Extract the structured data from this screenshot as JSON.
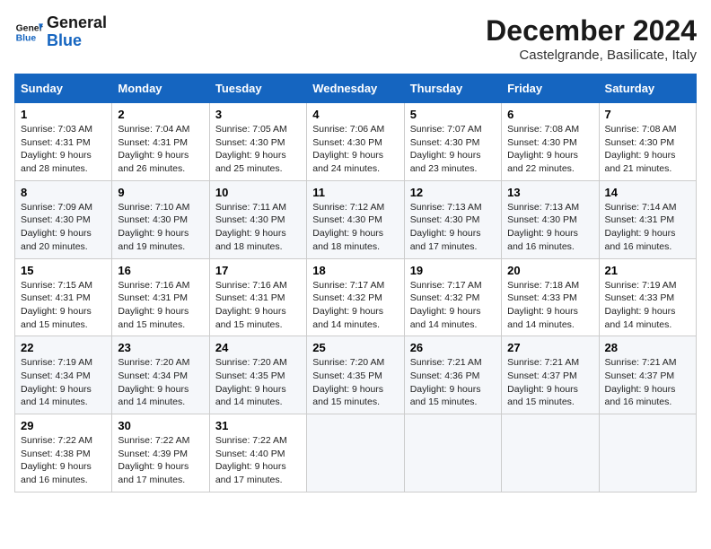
{
  "logo": {
    "line1": "General",
    "line2": "Blue"
  },
  "title": "December 2024",
  "location": "Castelgrande, Basilicate, Italy",
  "days_of_week": [
    "Sunday",
    "Monday",
    "Tuesday",
    "Wednesday",
    "Thursday",
    "Friday",
    "Saturday"
  ],
  "weeks": [
    [
      {
        "day": "1",
        "sunrise": "7:03 AM",
        "sunset": "4:31 PM",
        "daylight": "9 hours and 28 minutes."
      },
      {
        "day": "2",
        "sunrise": "7:04 AM",
        "sunset": "4:31 PM",
        "daylight": "9 hours and 26 minutes."
      },
      {
        "day": "3",
        "sunrise": "7:05 AM",
        "sunset": "4:30 PM",
        "daylight": "9 hours and 25 minutes."
      },
      {
        "day": "4",
        "sunrise": "7:06 AM",
        "sunset": "4:30 PM",
        "daylight": "9 hours and 24 minutes."
      },
      {
        "day": "5",
        "sunrise": "7:07 AM",
        "sunset": "4:30 PM",
        "daylight": "9 hours and 23 minutes."
      },
      {
        "day": "6",
        "sunrise": "7:08 AM",
        "sunset": "4:30 PM",
        "daylight": "9 hours and 22 minutes."
      },
      {
        "day": "7",
        "sunrise": "7:08 AM",
        "sunset": "4:30 PM",
        "daylight": "9 hours and 21 minutes."
      }
    ],
    [
      {
        "day": "8",
        "sunrise": "7:09 AM",
        "sunset": "4:30 PM",
        "daylight": "9 hours and 20 minutes."
      },
      {
        "day": "9",
        "sunrise": "7:10 AM",
        "sunset": "4:30 PM",
        "daylight": "9 hours and 19 minutes."
      },
      {
        "day": "10",
        "sunrise": "7:11 AM",
        "sunset": "4:30 PM",
        "daylight": "9 hours and 18 minutes."
      },
      {
        "day": "11",
        "sunrise": "7:12 AM",
        "sunset": "4:30 PM",
        "daylight": "9 hours and 18 minutes."
      },
      {
        "day": "12",
        "sunrise": "7:13 AM",
        "sunset": "4:30 PM",
        "daylight": "9 hours and 17 minutes."
      },
      {
        "day": "13",
        "sunrise": "7:13 AM",
        "sunset": "4:30 PM",
        "daylight": "9 hours and 16 minutes."
      },
      {
        "day": "14",
        "sunrise": "7:14 AM",
        "sunset": "4:31 PM",
        "daylight": "9 hours and 16 minutes."
      }
    ],
    [
      {
        "day": "15",
        "sunrise": "7:15 AM",
        "sunset": "4:31 PM",
        "daylight": "9 hours and 15 minutes."
      },
      {
        "day": "16",
        "sunrise": "7:16 AM",
        "sunset": "4:31 PM",
        "daylight": "9 hours and 15 minutes."
      },
      {
        "day": "17",
        "sunrise": "7:16 AM",
        "sunset": "4:31 PM",
        "daylight": "9 hours and 15 minutes."
      },
      {
        "day": "18",
        "sunrise": "7:17 AM",
        "sunset": "4:32 PM",
        "daylight": "9 hours and 14 minutes."
      },
      {
        "day": "19",
        "sunrise": "7:17 AM",
        "sunset": "4:32 PM",
        "daylight": "9 hours and 14 minutes."
      },
      {
        "day": "20",
        "sunrise": "7:18 AM",
        "sunset": "4:33 PM",
        "daylight": "9 hours and 14 minutes."
      },
      {
        "day": "21",
        "sunrise": "7:19 AM",
        "sunset": "4:33 PM",
        "daylight": "9 hours and 14 minutes."
      }
    ],
    [
      {
        "day": "22",
        "sunrise": "7:19 AM",
        "sunset": "4:34 PM",
        "daylight": "9 hours and 14 minutes."
      },
      {
        "day": "23",
        "sunrise": "7:20 AM",
        "sunset": "4:34 PM",
        "daylight": "9 hours and 14 minutes."
      },
      {
        "day": "24",
        "sunrise": "7:20 AM",
        "sunset": "4:35 PM",
        "daylight": "9 hours and 14 minutes."
      },
      {
        "day": "25",
        "sunrise": "7:20 AM",
        "sunset": "4:35 PM",
        "daylight": "9 hours and 15 minutes."
      },
      {
        "day": "26",
        "sunrise": "7:21 AM",
        "sunset": "4:36 PM",
        "daylight": "9 hours and 15 minutes."
      },
      {
        "day": "27",
        "sunrise": "7:21 AM",
        "sunset": "4:37 PM",
        "daylight": "9 hours and 15 minutes."
      },
      {
        "day": "28",
        "sunrise": "7:21 AM",
        "sunset": "4:37 PM",
        "daylight": "9 hours and 16 minutes."
      }
    ],
    [
      {
        "day": "29",
        "sunrise": "7:22 AM",
        "sunset": "4:38 PM",
        "daylight": "9 hours and 16 minutes."
      },
      {
        "day": "30",
        "sunrise": "7:22 AM",
        "sunset": "4:39 PM",
        "daylight": "9 hours and 17 minutes."
      },
      {
        "day": "31",
        "sunrise": "7:22 AM",
        "sunset": "4:40 PM",
        "daylight": "9 hours and 17 minutes."
      },
      null,
      null,
      null,
      null
    ]
  ],
  "labels": {
    "sunrise": "Sunrise:",
    "sunset": "Sunset:",
    "daylight": "Daylight:"
  }
}
